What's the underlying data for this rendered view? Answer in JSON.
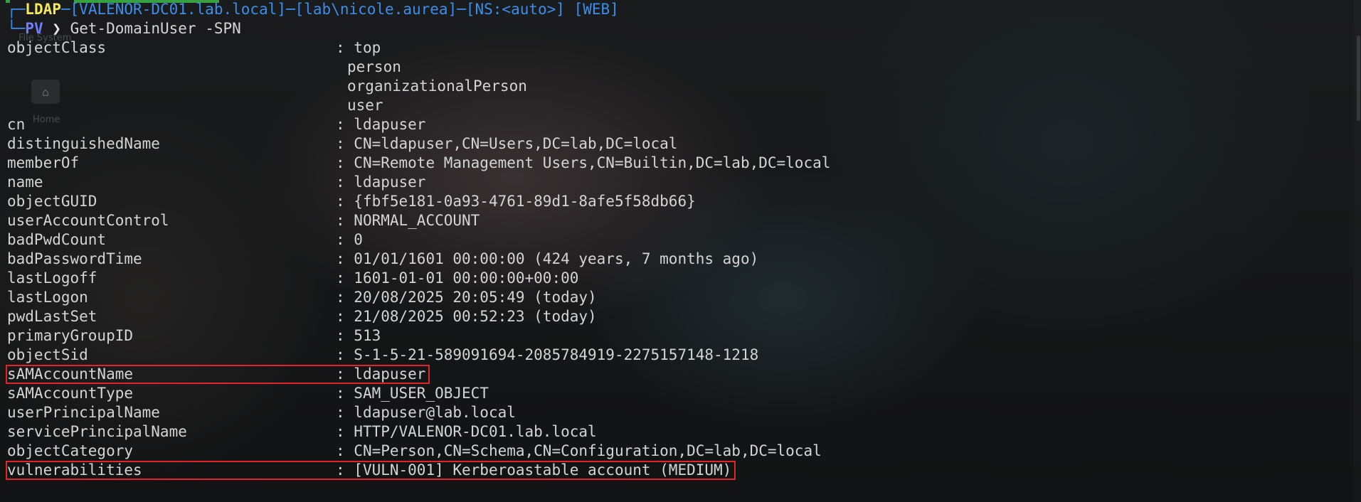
{
  "desktop": {
    "items": [
      {
        "label": "File System",
        "icon": "folder-icon"
      },
      {
        "label": "Home",
        "icon": "home-icon"
      }
    ]
  },
  "prompt": {
    "corner_top": "┌─",
    "context": "LDAP",
    "host": "[VALENOR-DC01.lab.local]",
    "user": "[lab\\nicole.aurea]",
    "ns": "[NS:<auto>]",
    "mode": "[WEB]",
    "corner_bottom": "└─",
    "shell": "PV",
    "arrow": "❯",
    "command": "Get-DomainUser -SPN"
  },
  "output": {
    "separator": ": ",
    "rows": [
      {
        "key": "objectClass",
        "value": "top"
      },
      {
        "key": "",
        "value": "person",
        "continuation": true
      },
      {
        "key": "",
        "value": "organizationalPerson",
        "continuation": true
      },
      {
        "key": "",
        "value": "user",
        "continuation": true
      },
      {
        "key": "cn",
        "value": "ldapuser"
      },
      {
        "key": "distinguishedName",
        "value": "CN=ldapuser,CN=Users,DC=lab,DC=local"
      },
      {
        "key": "memberOf",
        "value": "CN=Remote Management Users,CN=Builtin,DC=lab,DC=local"
      },
      {
        "key": "name",
        "value": "ldapuser"
      },
      {
        "key": "objectGUID",
        "value": "{fbf5e181-0a93-4761-89d1-8afe5f58db66}"
      },
      {
        "key": "userAccountControl",
        "value": "NORMAL_ACCOUNT"
      },
      {
        "key": "badPwdCount",
        "value": "0"
      },
      {
        "key": "badPasswordTime",
        "value": "01/01/1601 00:00:00 (424 years, 7 months ago)"
      },
      {
        "key": "lastLogoff",
        "value": "1601-01-01 00:00:00+00:00"
      },
      {
        "key": "lastLogon",
        "value": "20/08/2025 20:05:49 (today)"
      },
      {
        "key": "pwdLastSet",
        "value": "21/08/2025 00:52:23 (today)"
      },
      {
        "key": "primaryGroupID",
        "value": "513"
      },
      {
        "key": "objectSid",
        "value": "S-1-5-21-589091694-2085784919-2275157148-1218"
      },
      {
        "key": "sAMAccountName",
        "value": "ldapuser",
        "highlight": true
      },
      {
        "key": "sAMAccountType",
        "value": "SAM_USER_OBJECT"
      },
      {
        "key": "userPrincipalName",
        "value": "ldapuser@lab.local"
      },
      {
        "key": "servicePrincipalName",
        "value": "HTTP/VALENOR-DC01.lab.local"
      },
      {
        "key": "objectCategory",
        "value": "CN=Person,CN=Schema,CN=Configuration,DC=lab,DC=local"
      },
      {
        "key": "vulnerabilities",
        "value": "[VULN-001] Kerberoastable account (MEDIUM)",
        "highlight": true
      }
    ]
  },
  "colors": {
    "highlight_border": "#e0262b",
    "prompt_blue": "#3b8eea",
    "prompt_yellow": "#f5e95b",
    "prompt_purple": "#6f7dff"
  }
}
